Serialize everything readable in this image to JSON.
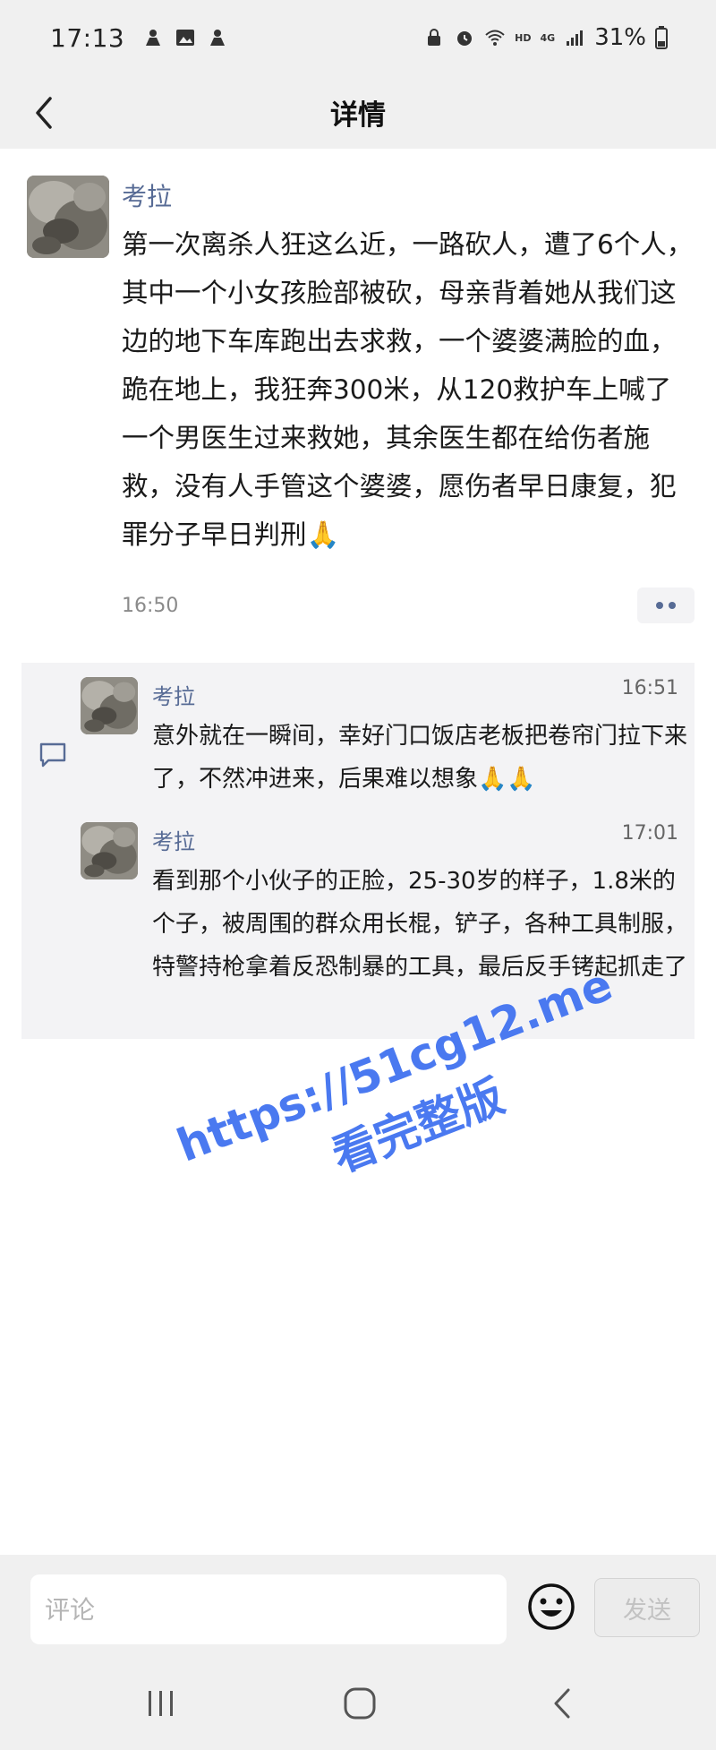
{
  "status_bar": {
    "time": "17:13",
    "network": "4G",
    "hd": "HD",
    "battery": "31%"
  },
  "header": {
    "title": "详情"
  },
  "post": {
    "author": "考拉",
    "text": "第一次离杀人狂这么近，一路砍人，遭了6个人，其中一个小女孩脸部被砍，母亲背着她从我们这边的地下车库跑出去求救，一个婆婆满脸的血，跪在地上，我狂奔300米，从120救护车上喊了一个男医生过来救她，其余医生都在给伤者施救，没有人手管这个婆婆，愿伤者早日康复，犯罪分子早日判刑🙏",
    "time": "16:50"
  },
  "comments": [
    {
      "author": "考拉",
      "time": "16:51",
      "text": "意外就在一瞬间，幸好门口饭店老板把卷帘门拉下来了，不然冲进来，后果难以想象🙏🙏"
    },
    {
      "author": "考拉",
      "time": "17:01",
      "text": "看到那个小伙子的正脸，25-30岁的样子，1.8米的个子，被周围的群众用长棍，铲子，各种工具制服，特警持枪拿着反恐制暴的工具，最后反手铐起抓走了"
    }
  ],
  "watermark": {
    "line1": "https://51cg12.me",
    "line2": "看完整版"
  },
  "input_bar": {
    "placeholder": "评论",
    "send_label": "发送"
  },
  "colors": {
    "link_blue": "#576b95",
    "watermark_blue": "#4a79f0"
  }
}
